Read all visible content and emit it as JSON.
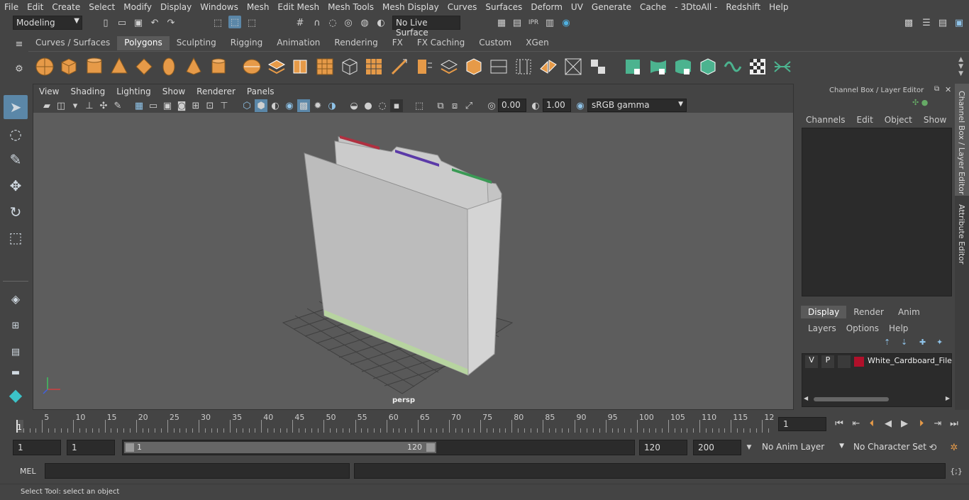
{
  "menubar": {
    "items": [
      "File",
      "Edit",
      "Create",
      "Select",
      "Modify",
      "Display",
      "Windows",
      "Mesh",
      "Edit Mesh",
      "Mesh Tools",
      "Mesh Display",
      "Curves",
      "Surfaces",
      "Deform",
      "UV",
      "Generate",
      "Cache",
      "- 3DtoAll -",
      "Redshift",
      "Help"
    ]
  },
  "statusline": {
    "mode": "Modeling",
    "live_surface": "No Live Surface"
  },
  "shelf": {
    "tabs": [
      "Curves / Surfaces",
      "Polygons",
      "Sculpting",
      "Rigging",
      "Animation",
      "Rendering",
      "FX",
      "FX Caching",
      "Custom",
      "XGen"
    ],
    "active_tab": "Polygons"
  },
  "viewport": {
    "menu": [
      "View",
      "Shading",
      "Lighting",
      "Show",
      "Renderer",
      "Panels"
    ],
    "exposure": "0.00",
    "gamma": "1.00",
    "color_space": "sRGB gamma",
    "camera_label": "persp"
  },
  "channel_box": {
    "title": "Channel Box / Layer Editor",
    "menu": [
      "Channels",
      "Edit",
      "Object",
      "Show"
    ],
    "side_tab_1": "Channel Box / Layer Editor",
    "side_tab_2": "Attribute Editor"
  },
  "layer_editor": {
    "tabs": [
      "Display",
      "Render",
      "Anim"
    ],
    "active_tab": "Display",
    "menu": [
      "Layers",
      "Options",
      "Help"
    ],
    "layers": [
      {
        "v": "V",
        "p": "P",
        "color": "#b0102a",
        "name": "White_Cardboard_File"
      }
    ]
  },
  "timeline": {
    "ticks": [
      "5",
      "10",
      "15",
      "20",
      "25",
      "30",
      "35",
      "40",
      "45",
      "50",
      "55",
      "60",
      "65",
      "70",
      "75",
      "80",
      "85",
      "90",
      "95",
      "100",
      "105",
      "110",
      "115",
      "12"
    ],
    "start_marker": "1",
    "current_frame": "1"
  },
  "range": {
    "start": "1",
    "playback_start": "1",
    "slider_start": "1",
    "slider_end": "120",
    "playback_end": "120",
    "end": "200",
    "anim_layer": "No Anim Layer",
    "character_set": "No Character Set"
  },
  "mel": {
    "label": "MEL"
  },
  "help_line": "Select Tool: select an object"
}
